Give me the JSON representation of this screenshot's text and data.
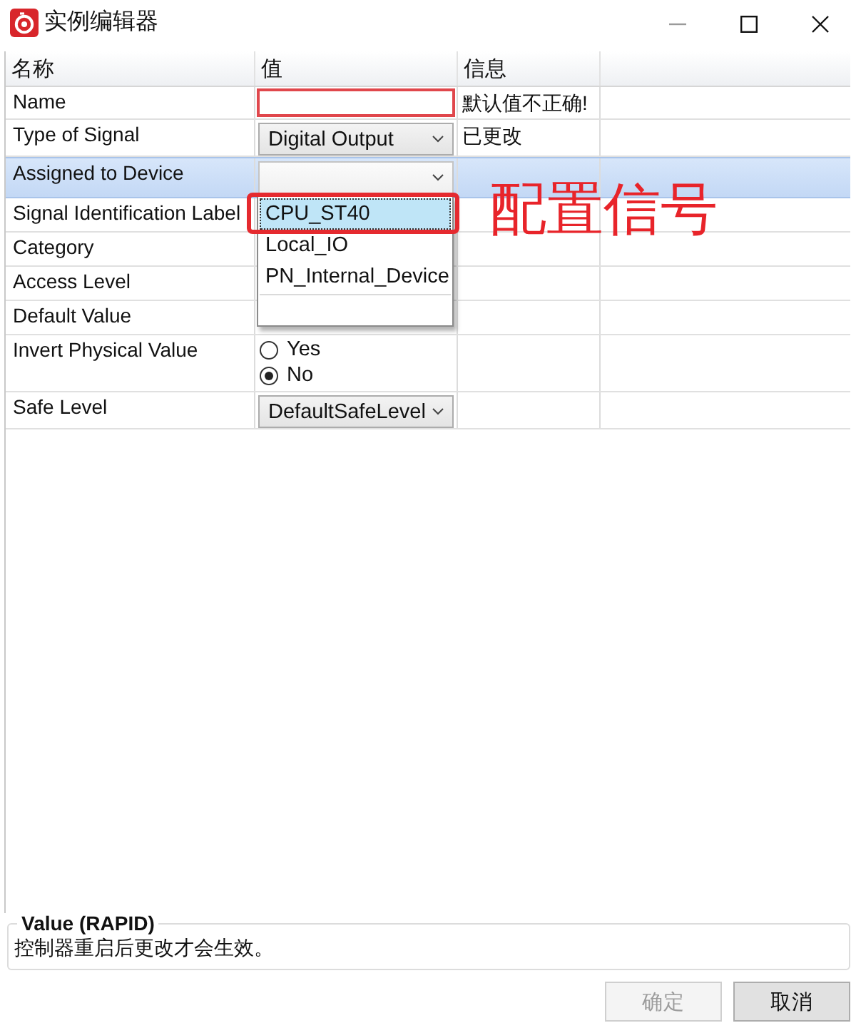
{
  "window": {
    "title": "实例编辑器"
  },
  "table": {
    "columns": [
      "名称",
      "值",
      "信息"
    ],
    "rows": [
      {
        "name": "Name",
        "kind": "text",
        "invalid": true,
        "info": "默认值不正确!",
        "selected": false
      },
      {
        "name": "Type of Signal",
        "kind": "dropdown",
        "value": "Digital Output",
        "expanded": false,
        "info": "已更改",
        "selected": false
      },
      {
        "name": "Assigned to Device",
        "kind": "dropdown",
        "expanded": true,
        "selected": true,
        "options": [
          {
            "label": "CPU_ST40",
            "selected": true
          },
          {
            "label": "Local_IO",
            "selected": false
          },
          {
            "label": "PN_Internal_Device",
            "selected": false
          }
        ]
      },
      {
        "name": "Signal Identification Label",
        "kind": "blank",
        "selected": false
      },
      {
        "name": "Category",
        "kind": "blank",
        "selected": false
      },
      {
        "name": "Access Level",
        "kind": "blank",
        "selected": false
      },
      {
        "name": "Default Value",
        "kind": "blank",
        "selected": false
      },
      {
        "name": "Invert Physical Value",
        "kind": "radio",
        "selected": false,
        "options": [
          {
            "label": "Yes",
            "selected": false
          },
          {
            "label": "No",
            "selected": true
          }
        ]
      },
      {
        "name": "Safe Level",
        "kind": "dropdown",
        "value": "DefaultSafeLevel",
        "expanded": false,
        "selected": false
      }
    ]
  },
  "annotation": {
    "text": "配置信号"
  },
  "description": {
    "title": "Value (RAPID)",
    "text": "控制器重启后更改才会生效。"
  },
  "buttons": [
    {
      "label": "确定",
      "disabled": true
    },
    {
      "label": "取消",
      "disabled": false
    }
  ]
}
